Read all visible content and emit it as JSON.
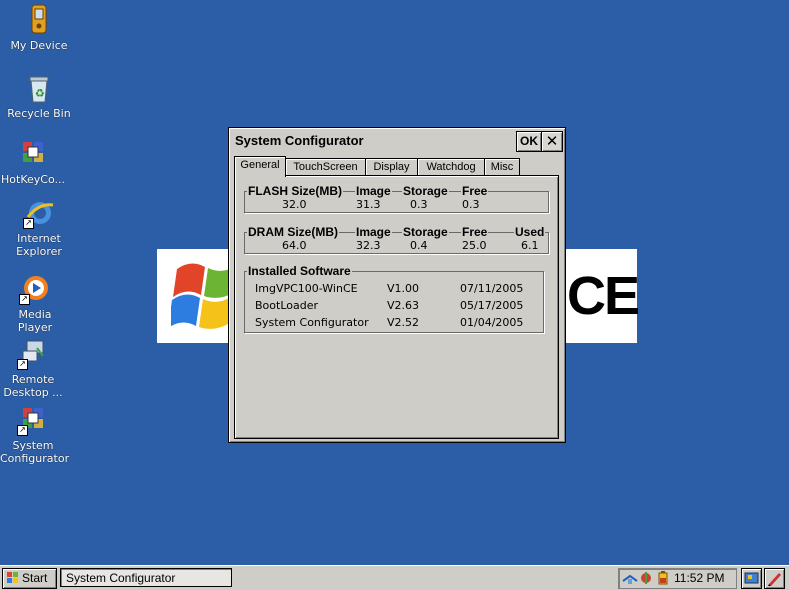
{
  "desktop": {
    "icons": [
      {
        "label": "My Device",
        "icon": "pda-icon"
      },
      {
        "label": "Recycle Bin",
        "icon": "recycle-bin-icon"
      },
      {
        "label": "HotKeyCo...",
        "icon": "hotkey-icon"
      },
      {
        "label": "Internet Explorer",
        "icon": "ie-icon"
      },
      {
        "label": "Media Player",
        "icon": "media-player-icon"
      },
      {
        "label": "Remote Desktop ...",
        "icon": "remote-desktop-icon"
      },
      {
        "label": "System Configurator",
        "icon": "system-configurator-icon"
      }
    ],
    "wallpaper_text": "CE"
  },
  "dialog": {
    "title": "System Configurator",
    "ok_label": "OK",
    "close_label": "✕",
    "tabs": [
      "General",
      "TouchScreen",
      "Display",
      "Watchdog",
      "Misc"
    ],
    "active_tab": "General",
    "flash": {
      "header": "FLASH Size(MB)",
      "cols": [
        "Image",
        "Storage",
        "Free"
      ],
      "size": "32.0",
      "values": [
        "31.3",
        "0.3",
        "0.3"
      ]
    },
    "dram": {
      "header": "DRAM Size(MB)",
      "cols": [
        "Image",
        "Storage",
        "Free",
        "Used"
      ],
      "size": "64.0",
      "values": [
        "32.3",
        "0.4",
        "25.0",
        "6.1"
      ]
    },
    "software": {
      "header": "Installed Software",
      "rows": [
        {
          "name": "ImgVPC100-WinCE",
          "version": "V1.00",
          "date": "07/11/2005"
        },
        {
          "name": "BootLoader",
          "version": "V2.63",
          "date": "05/17/2005"
        },
        {
          "name": "System Configurator",
          "version": "V2.52",
          "date": "01/04/2005"
        }
      ]
    }
  },
  "taskbar": {
    "start_label": "Start",
    "task_label": "System Configurator",
    "clock": "11:52 PM"
  },
  "colors": {
    "desktop": "#2b5ea6",
    "window_face": "#cfcdc8"
  }
}
